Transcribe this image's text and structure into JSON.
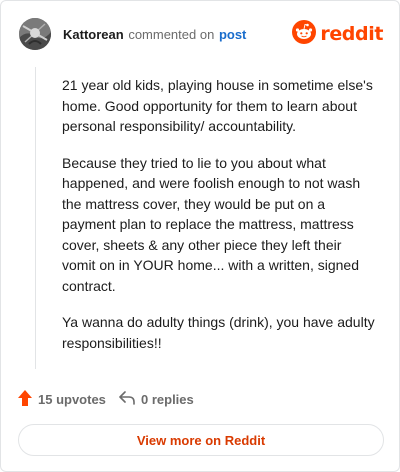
{
  "comment": {
    "username": "Kattorean",
    "action": "commented on",
    "post_link": "post",
    "paragraphs": [
      "21 year old kids, playing house in sometime else's home. Good opportunity for them to learn about personal responsibility/ accountability.",
      "Because they tried to lie to you about what happened, and were foolish enough to not wash the mattress cover, they would be put on a payment plan to replace the mattress, mattress cover, sheets & any other piece they left their vomit on in YOUR home... with a written, signed contract.",
      "Ya wanna do adulty things (drink), you have adulty responsibilities!!"
    ]
  },
  "brand": {
    "name": "reddit",
    "color": "#ff4500"
  },
  "footer": {
    "upvotes": "15 upvotes",
    "replies": "0 replies",
    "upvote_color": "#ff4500"
  },
  "cta": {
    "label": "View more on Reddit",
    "color": "#d93a00"
  }
}
